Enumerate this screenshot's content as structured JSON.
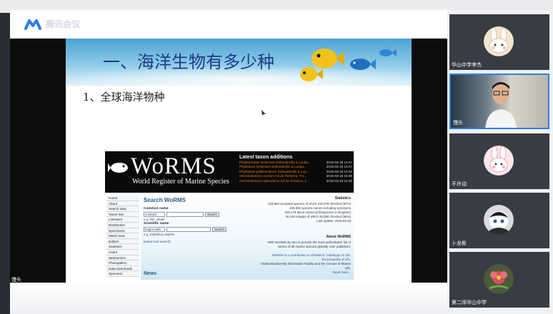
{
  "app": {
    "title": "腾讯会议"
  },
  "slide": {
    "title": "一、海洋生物有多少种",
    "subtitle": "1、全球海洋物种"
  },
  "worms": {
    "name": "WoRMS",
    "tagline": "World Register of Marine Species",
    "latest_title": "Latest taxon additions",
    "latest": [
      {
        "name": "Phyllodocidae Delamare Deboutteville & Lauba...",
        "date": "2015-03-18 13:47"
      },
      {
        "name": "Phyllodoce Delamare Deboutteville & Lauba...",
        "date": "2015-03-18 13:47"
      },
      {
        "name": "Phyllodoce publiceolarum Deboutteville & Lau...",
        "date": "2015-03-18 12:42"
      },
      {
        "name": "Oecistodontium cinctum Gil de Pertierra, Tro...",
        "date": "2015-03-18 15:38"
      },
      {
        "name": "Oecistodontium splendidum Gil de Pertierra, 1...",
        "date": "2015-03-18 15:38"
      }
    ],
    "nav": [
      "Home",
      "About",
      "Search taxa",
      "Taxon tree",
      "Literature",
      "Distribution",
      "Specimens",
      "Match taxa",
      "Editors",
      "Statistics",
      "Users",
      "Webservice",
      "Photogallery",
      "Data downloads",
      "Sponsors"
    ],
    "search": {
      "title": "Search WoRMS",
      "common_label": "Common name",
      "common_select": "contains",
      "common_note": "e.g. fish, whale",
      "sci_label": "Scientific name",
      "sci_select": "begins with",
      "sci_note": "e.g. Delphinus delphis",
      "search_btn": "Search",
      "advanced": "[advanced search]"
    },
    "news_title": "News",
    "stats_title": "Statistics",
    "stats": [
      "229,550 accepted species of which 216,278 checked (94%)",
      "435,592 species names including synonyms",
      "529,178 taxon names (infraspecies to kingdom)",
      "30,150 images of which 20,090 checked (66%)",
      "Last update: 2015-03-18"
    ],
    "about_title": "About WoRMS",
    "about": [
      "With WoRMS we aim to provide the most authoritative list of",
      "names of all marine species globally, ever published.",
      "",
      "WoRMS is a contribution to LifeWatch, Catalogue of Life,",
      "Encyclopedia of Life,",
      "Global Biodiversity Information Facility and the Census of Marine",
      "Life.",
      "Read more..."
    ]
  },
  "presenter_name": "馒头",
  "participants": [
    {
      "name": "华山中学李杰",
      "avatar": "bunny-avatar-icon",
      "type": "avatar"
    },
    {
      "name": "馒头",
      "avatar": "camera-video",
      "type": "video",
      "active": true
    },
    {
      "name": "不许动",
      "avatar": "bunny-pink-avatar-icon",
      "type": "avatar"
    },
    {
      "name": "卜龙彬",
      "avatar": "character-avatar-icon",
      "type": "avatar"
    },
    {
      "name": "第二师华山中学",
      "avatar": "flower-avatar-icon",
      "type": "avatar"
    }
  ],
  "colors": {
    "accent": "#2f7ee8",
    "slide_title": "#1f3a8a",
    "worms_link": "#2a5a8c",
    "worms_latest": "#e37a2b"
  }
}
